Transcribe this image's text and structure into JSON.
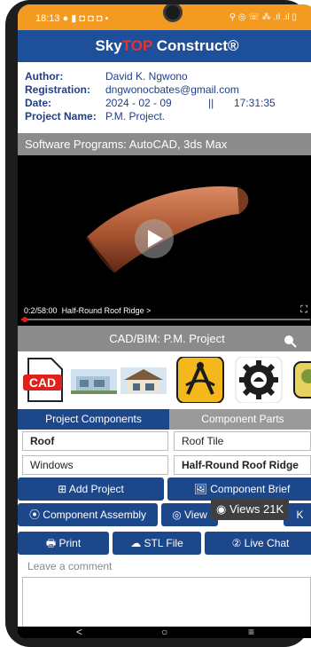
{
  "status": {
    "time": "18:13 ● ▮ ◘ ◘ ◘ •",
    "icons": "⚲ ◎ ☏ ⁂ .ıl .ıl ▯"
  },
  "app": {
    "title_prefix": "Sky",
    "title_highlight": "TOP",
    "title_suffix": " Construct®",
    "brand_color": "#1d4f9a",
    "accent": "#e2352f"
  },
  "info": {
    "author_label": "Author:",
    "author_value": "David K. Ngwono",
    "registration_label": "Registration:",
    "registration_value": "dngwonocbates@gmail.com",
    "date_label": "Date:",
    "date_value": "2024 - 02 - 09",
    "time_sep": "||",
    "time_value": "17:31:35",
    "project_label": "Project Name:",
    "project_value": "P.M. Project."
  },
  "software": "Software Programs: AutoCAD, 3ds Max",
  "video": {
    "time": "0:2/58:00",
    "title": "Half-Round Roof Ridge >",
    "progress": 0.01
  },
  "cad_bar": {
    "label": "CAD/BIM: P.M. Project",
    "icon": "search-icon"
  },
  "tabs": {
    "left": "Project Components",
    "right": "Component Parts"
  },
  "fields": {
    "roof": "Roof",
    "roof_tile": "Roof Tile",
    "windows": "Windows",
    "ridge": "Half-Round Roof Ridge"
  },
  "buttons": {
    "add_project": "⊞ Add Project",
    "component_brief": "🖼 Component Brief",
    "component_assembly": "⦿ Component Assembly",
    "view": "◎ View",
    "k": "K",
    "print": "🖶 Print",
    "stl": "☁ STL File",
    "chat": "② Live Chat"
  },
  "views_badge": "Views 21K",
  "comment_placeholder": "Leave a comment",
  "nav": {
    "back": "<",
    "home": "○",
    "menu": "≡"
  }
}
